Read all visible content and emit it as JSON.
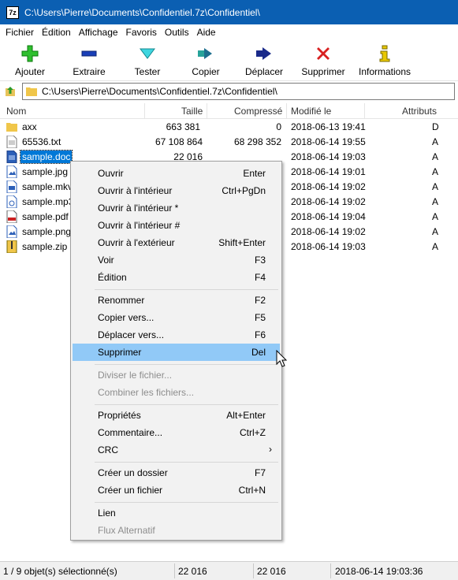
{
  "window": {
    "title": "C:\\Users\\Pierre\\Documents\\Confidentiel.7z\\Confidentiel\\",
    "app_icon": "7z"
  },
  "menu": [
    "Fichier",
    "Édition",
    "Affichage",
    "Favoris",
    "Outils",
    "Aide"
  ],
  "toolbar": [
    {
      "label": "Ajouter",
      "icon": "plus-icon"
    },
    {
      "label": "Extraire",
      "icon": "minus-icon"
    },
    {
      "label": "Tester",
      "icon": "check-icon"
    },
    {
      "label": "Copier",
      "icon": "copy-arrow-icon"
    },
    {
      "label": "Déplacer",
      "icon": "move-arrow-icon"
    },
    {
      "label": "Supprimer",
      "icon": "delete-x-icon"
    },
    {
      "label": "Informations",
      "icon": "info-icon"
    }
  ],
  "address": {
    "path": "C:\\Users\\Pierre\\Documents\\Confidentiel.7z\\Confidentiel\\"
  },
  "columns": {
    "name": "Nom",
    "size": "Taille",
    "packed": "Compressé",
    "modified": "Modifié le",
    "attributes": "Attributs"
  },
  "files": [
    {
      "name": "axx",
      "size": "663 381",
      "packed": "0",
      "modified": "2018-06-13 19:41",
      "attr": "D",
      "type": "folder"
    },
    {
      "name": "65536.txt",
      "size": "67 108 864",
      "packed": "68 298 352",
      "modified": "2018-06-14 19:55",
      "attr": "A",
      "type": "txt"
    },
    {
      "name": "sample.doc",
      "size": "22 016",
      "packed": "",
      "modified": "2018-06-14 19:03",
      "attr": "A",
      "type": "doc",
      "selected": true
    },
    {
      "name": "sample.jpg",
      "size": "",
      "packed": "",
      "modified": "2018-06-14 19:01",
      "attr": "A",
      "type": "jpg"
    },
    {
      "name": "sample.mkv",
      "size": "",
      "packed": "",
      "modified": "2018-06-14 19:02",
      "attr": "A",
      "type": "mkv"
    },
    {
      "name": "sample.mp3",
      "size": "",
      "packed": "",
      "modified": "2018-06-14 19:02",
      "attr": "A",
      "type": "mp3"
    },
    {
      "name": "sample.pdf",
      "size": "",
      "packed": "",
      "modified": "2018-06-14 19:04",
      "attr": "A",
      "type": "pdf"
    },
    {
      "name": "sample.png",
      "size": "",
      "packed": "",
      "modified": "2018-06-14 19:02",
      "attr": "A",
      "type": "png"
    },
    {
      "name": "sample.zip",
      "size": "",
      "packed": "",
      "modified": "2018-06-14 19:03",
      "attr": "A",
      "type": "zip"
    }
  ],
  "context_menu": [
    {
      "label": "Ouvrir",
      "shortcut": "Enter"
    },
    {
      "label": "Ouvrir à l'intérieur",
      "shortcut": "Ctrl+PgDn"
    },
    {
      "label": "Ouvrir à l'intérieur *",
      "shortcut": ""
    },
    {
      "label": "Ouvrir à l'intérieur #",
      "shortcut": ""
    },
    {
      "label": "Ouvrir à l'extérieur",
      "shortcut": "Shift+Enter"
    },
    {
      "label": "Voir",
      "shortcut": "F3"
    },
    {
      "label": "Édition",
      "shortcut": "F4"
    },
    {
      "label": "Renommer",
      "shortcut": "F2"
    },
    {
      "label": "Copier vers...",
      "shortcut": "F5"
    },
    {
      "label": "Déplacer vers...",
      "shortcut": "F6"
    },
    {
      "label": "Supprimer",
      "shortcut": "Del",
      "highlighted": true
    },
    {
      "label": "Diviser le fichier...",
      "shortcut": "",
      "disabled": true
    },
    {
      "label": "Combiner les fichiers...",
      "shortcut": "",
      "disabled": true
    },
    {
      "label": "Propriétés",
      "shortcut": "Alt+Enter"
    },
    {
      "label": "Commentaire...",
      "shortcut": "Ctrl+Z"
    },
    {
      "label": "CRC",
      "shortcut": "",
      "submenu": true
    },
    {
      "label": "Créer un dossier",
      "shortcut": "F7"
    },
    {
      "label": "Créer un fichier",
      "shortcut": "Ctrl+N"
    },
    {
      "label": "Lien",
      "shortcut": ""
    },
    {
      "label": "Flux Alternatif",
      "shortcut": "",
      "disabled": true
    }
  ],
  "status": {
    "selection": "1 / 9 objet(s) sélectionné(s)",
    "size": "22 016",
    "packed": "22 016",
    "modified": "2018-06-14 19:03:36"
  },
  "colors": {
    "titlebar": "#0b5fb2",
    "selection": "#0078d7",
    "menu_highlight": "#91c9f7"
  }
}
